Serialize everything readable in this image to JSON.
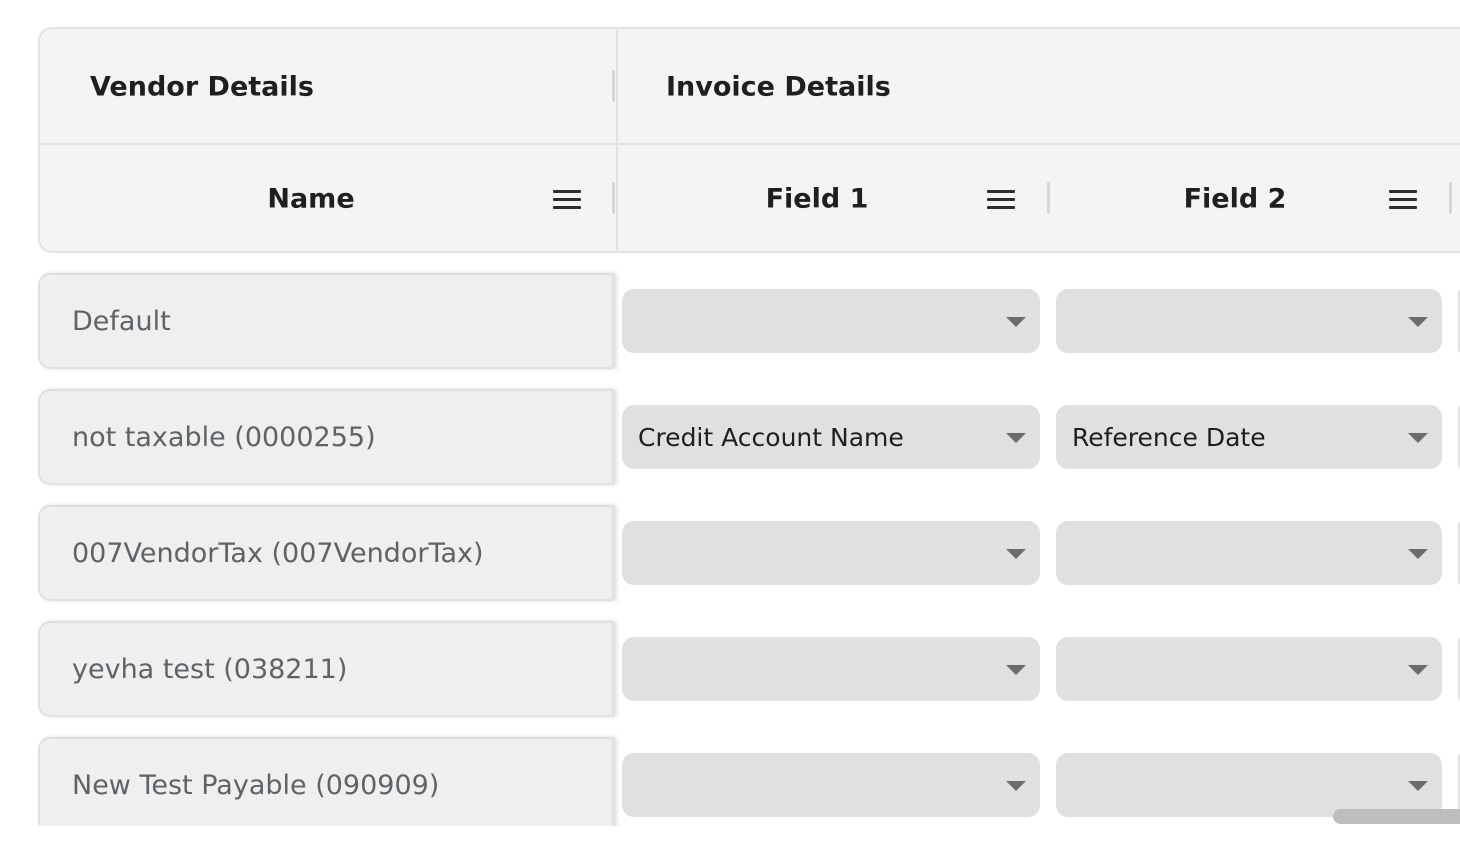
{
  "header": {
    "groups": {
      "vendor": "Vendor Details",
      "invoice": "Invoice Details"
    },
    "columns": {
      "name": "Name",
      "field1": "Field 1",
      "field2": "Field 2"
    },
    "icons": {
      "column_menu": "menu-icon"
    }
  },
  "rows": [
    {
      "name": "Default",
      "field1": "",
      "field2": ""
    },
    {
      "name": "not taxable (0000255)",
      "field1": "Credit Account Name",
      "field2": "Reference Date"
    },
    {
      "name": "007VendorTax (007VendorTax)",
      "field1": "",
      "field2": ""
    },
    {
      "name": "yevha test (038211)",
      "field1": "",
      "field2": ""
    },
    {
      "name": "New Test Payable (090909)",
      "field1": "",
      "field2": ""
    }
  ],
  "colors": {
    "header_bg": "#f4f4f4",
    "cell_bg": "#efefef",
    "dropdown_bg": "#e0e0e0",
    "border": "#e2e2e2",
    "text_dark": "#1f1f1f",
    "text_muted": "#5e6367"
  }
}
